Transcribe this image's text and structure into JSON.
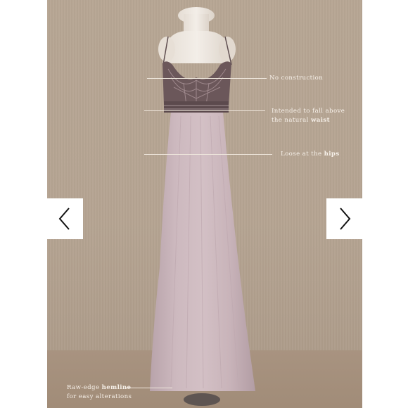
{
  "carousel": {
    "prev_icon": "chevron-left-icon",
    "next_icon": "chevron-right-icon"
  },
  "annotations": [
    {
      "parts": [
        "No construction",
        "",
        ""
      ]
    },
    {
      "parts": [
        "Intended to fall above",
        "the natural ",
        "waist"
      ]
    },
    {
      "parts": [
        "Loose at the ",
        "hips",
        ""
      ]
    },
    {
      "parts": [
        "Raw-edge ",
        "hemline",
        ""
      ],
      "line2": "for easy alterations"
    }
  ],
  "colors": {
    "backdrop": "#b5a492",
    "dress_skirt": "#c9b5bb",
    "bodice": "#6e5a5c",
    "nav_background": "#ffffff"
  }
}
